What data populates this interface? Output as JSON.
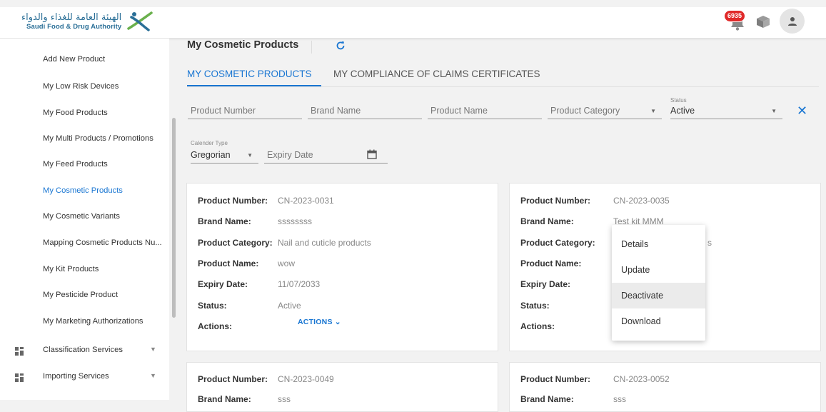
{
  "header": {
    "logo_arabic": "الهيئة العامة للغذاء والدواء",
    "logo_english": "Saudi Food & Drug Authority",
    "notification_count": "6935",
    "icons": [
      "bell-icon",
      "box-icon",
      "user-icon"
    ]
  },
  "sidebar": {
    "items": [
      {
        "label": "Add New Product"
      },
      {
        "label": "My Low Risk Devices"
      },
      {
        "label": "My Food Products"
      },
      {
        "label": "My Multi Products / Promotions"
      },
      {
        "label": "My Feed Products"
      },
      {
        "label": "My Cosmetic Products",
        "active": true
      },
      {
        "label": "My Cosmetic Variants"
      },
      {
        "label": "Mapping Cosmetic Products Nu..."
      },
      {
        "label": "My Kit Products"
      },
      {
        "label": "My Pesticide Product"
      },
      {
        "label": "My Marketing Authorizations"
      }
    ],
    "groups": [
      {
        "label": "Classification Services"
      },
      {
        "label": "Importing Services"
      }
    ]
  },
  "main": {
    "title": "My Cosmetic Products",
    "tabs": [
      {
        "label": "MY COSMETIC PRODUCTS",
        "active": true
      },
      {
        "label": "MY COMPLIANCE OF CLAIMS CERTIFICATES"
      }
    ]
  },
  "filters": {
    "product_number_placeholder": "Product Number",
    "brand_name_placeholder": "Brand Name",
    "product_name_placeholder": "Product Name",
    "product_category_placeholder": "Product Category",
    "status_label": "Status",
    "status_value": "Active",
    "calendar_type_label": "Calender Type",
    "calendar_type_value": "Gregorian",
    "expiry_date_placeholder": "Expiry Date"
  },
  "field_labels": {
    "product_number": "Product Number:",
    "brand_name": "Brand Name:",
    "product_category": "Product Category:",
    "product_name": "Product Name:",
    "expiry_date": "Expiry Date:",
    "status": "Status:",
    "actions": "Actions:"
  },
  "cards": [
    {
      "product_number": "CN-2023-0031",
      "brand_name": "ssssssss",
      "product_category": "Nail and cuticle products",
      "product_name": "wow",
      "expiry_date": "11/07/2033",
      "status": "Active",
      "actions_label": "ACTIONS ⌄"
    },
    {
      "product_number": "CN-2023-0035",
      "brand_name": "Test kit MMM",
      "product_category_partial": "s"
    },
    {
      "product_number": "CN-2023-0049",
      "brand_name": "sss"
    },
    {
      "product_number": "CN-2023-0052",
      "brand_name": "sss"
    }
  ],
  "actions_menu": {
    "items": [
      "Details",
      "Update",
      "Deactivate",
      "Download"
    ],
    "hovered": "Deactivate"
  },
  "colors": {
    "accent": "#1976d2",
    "badge": "#e02929",
    "sidebar_bg": "#ffffff",
    "page_bg": "#f2f2f2"
  }
}
